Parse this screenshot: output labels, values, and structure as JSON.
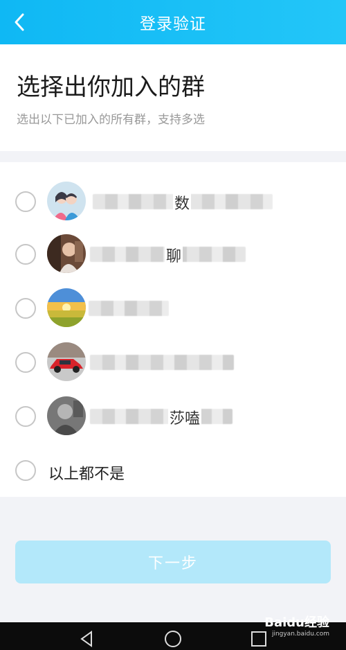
{
  "header": {
    "title": "登录验证",
    "back_icon": "chevron-left-icon"
  },
  "intro": {
    "title": "选择出你加入的群",
    "subtitle": "选出以下已加入的所有群，支持多选"
  },
  "groups": [
    {
      "visible_fragment": "数",
      "avatar": "couple-avatar"
    },
    {
      "visible_fragment": "聊",
      "avatar": "photo-avatar"
    },
    {
      "visible_fragment": "",
      "avatar": "sunset-field-avatar"
    },
    {
      "visible_fragment": "",
      "avatar": "red-car-avatar"
    },
    {
      "visible_fragment": "莎嗑",
      "avatar": "grayscale-photo-avatar"
    }
  ],
  "none_option": "以上都不是",
  "next_button": "下一步",
  "watermark": {
    "brand": "Baidu经验",
    "url": "jingyan.baidu.com"
  },
  "colors": {
    "accent": "#12bdf6",
    "button_disabled": "#b3e8fa"
  }
}
